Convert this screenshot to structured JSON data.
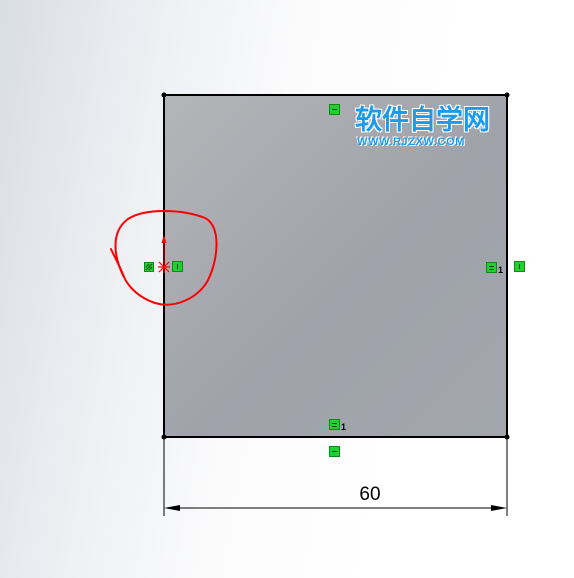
{
  "dimension": {
    "value": "60"
  },
  "relations": {
    "horizontal_sub_right": "1",
    "horizontal_sub_bottom": "1"
  },
  "watermark": {
    "chinese": "软件自学网",
    "url": "WWW.RJZXW.COM"
  },
  "colors": {
    "sketch_line": "#000000",
    "face_fill_light": "#b5b6ba",
    "face_fill_dark": "#9a9da6",
    "relation_green": "#1fd12d",
    "origin_red": "#ff0000",
    "annotation_red": "#ff0000",
    "watermark_blue": "#1a9bf0"
  },
  "icons": {
    "origin": "origin-icon",
    "relation_horizontal": "horizontal-relation-icon",
    "relation_vertical": "vertical-relation-icon",
    "fix_point": "fixed-point-icon"
  }
}
